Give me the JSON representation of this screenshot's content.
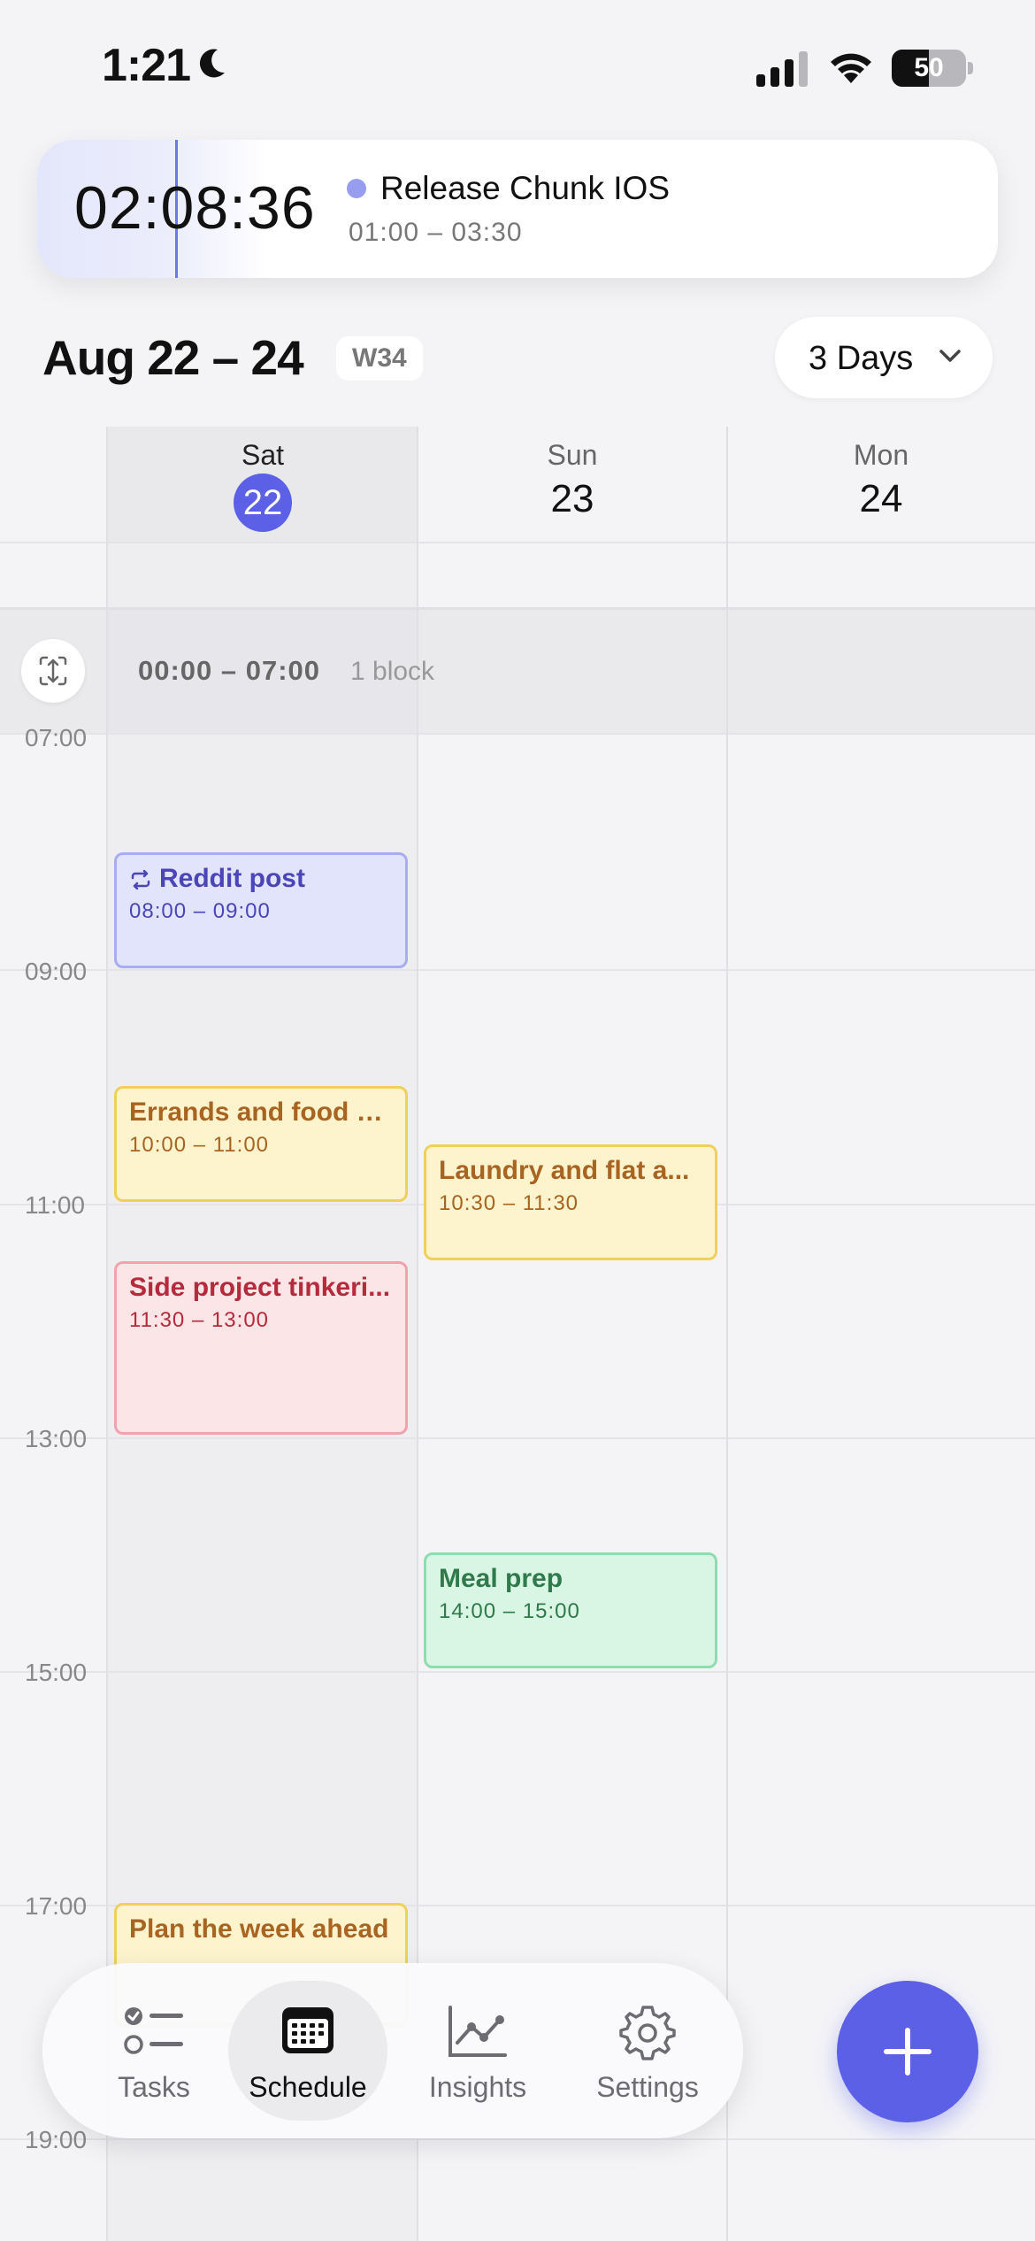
{
  "status_bar": {
    "time": "1:21",
    "battery": "50"
  },
  "live_activity": {
    "timer": "02:08:36",
    "title": "Release Chunk IOS",
    "range": "01:00 – 03:30",
    "dot_color": "#979df0"
  },
  "header": {
    "date_range": "Aug 22 – 24",
    "week": "W34",
    "view_label": "3 Days"
  },
  "days": [
    {
      "name": "Sat",
      "num": "22",
      "today": true
    },
    {
      "name": "Sun",
      "num": "23",
      "today": false
    },
    {
      "name": "Mon",
      "num": "24",
      "today": false
    }
  ],
  "collapsed": {
    "range": "00:00 – 07:00",
    "count": "1 block"
  },
  "hours": [
    "07:00",
    "09:00",
    "11:00",
    "13:00",
    "15:00",
    "17:00",
    "19:00"
  ],
  "events": [
    {
      "title": "Reddit post",
      "time": "08:00 – 09:00",
      "color": "blue",
      "recurring": true
    },
    {
      "title": "Errands and food s...",
      "time": "10:00 – 11:00",
      "color": "yellow"
    },
    {
      "title": "Laundry and flat a...",
      "time": "10:30 – 11:30",
      "color": "yellow"
    },
    {
      "title": "Side project tinkeri...",
      "time": "11:30 – 13:00",
      "color": "red"
    },
    {
      "title": "Meal prep",
      "time": "14:00 – 15:00",
      "color": "green"
    },
    {
      "title": "Plan the week ahead",
      "time": "",
      "color": "yellow"
    }
  ],
  "tabs": [
    {
      "label": "Tasks",
      "icon": "tasks-icon"
    },
    {
      "label": "Schedule",
      "icon": "calendar-icon",
      "active": true
    },
    {
      "label": "Insights",
      "icon": "chart-icon"
    },
    {
      "label": "Settings",
      "icon": "gear-icon"
    }
  ],
  "colors": {
    "accent": "#5b60e7"
  }
}
